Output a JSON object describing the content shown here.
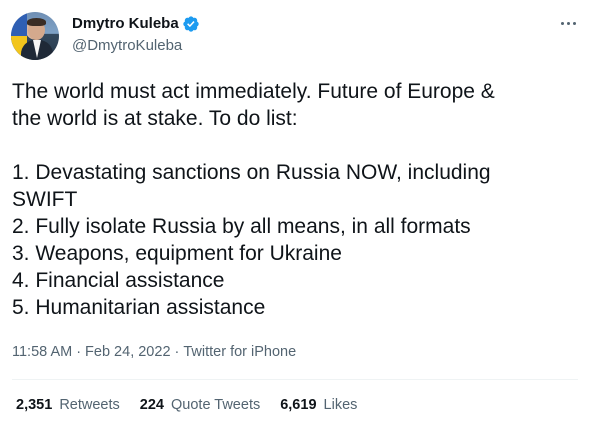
{
  "user": {
    "display_name": "Dmytro Kuleba",
    "handle": "@DmytroKuleba",
    "verified": true,
    "verified_color": "#1d9bf0"
  },
  "tweet": {
    "text": "The world must act immediately. Future of Europe &\nthe world is at stake. To do list:\n\n1. Devastating sanctions on Russia NOW, including\nSWIFT\n2. Fully isolate Russia by all means, in all formats\n3. Weapons, equipment for Ukraine\n4. Financial assistance\n5. Humanitarian assistance",
    "time": "11:58 AM",
    "separator": "·",
    "date": "Feb 24, 2022",
    "source": "Twitter for iPhone"
  },
  "stats": {
    "retweets_count": "2,351",
    "retweets_label": "Retweets",
    "quotes_count": "224",
    "quotes_label": "Quote Tweets",
    "likes_count": "6,619",
    "likes_label": "Likes"
  },
  "icons": {
    "more": "more-options-icon",
    "verified": "verified-badge-icon"
  }
}
